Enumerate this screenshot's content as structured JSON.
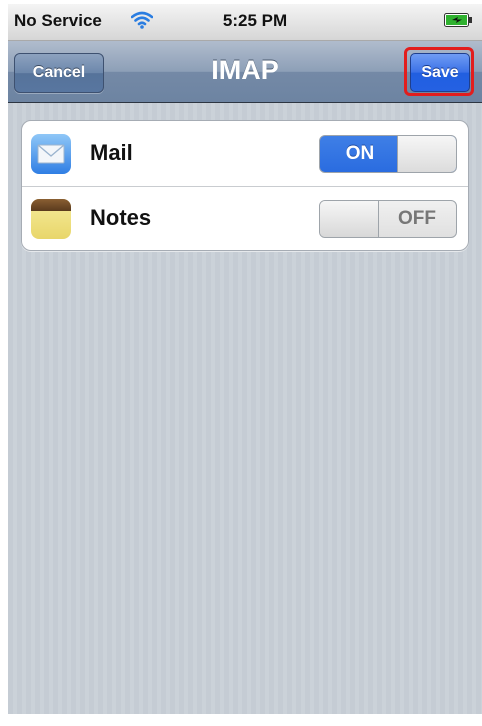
{
  "status_bar": {
    "carrier": "No Service",
    "wifi_icon": "wifi-icon",
    "time": "5:25 PM",
    "battery_icon": "battery-charging-icon"
  },
  "nav_bar": {
    "title": "IMAP",
    "cancel_label": "Cancel",
    "save_label": "Save",
    "save_highlight_color": "#e21d1d"
  },
  "settings": [
    {
      "label": "Mail",
      "icon": "mail-icon",
      "toggle": "ON",
      "enabled": true
    },
    {
      "label": "Notes",
      "icon": "notes-icon",
      "toggle": "OFF",
      "enabled": false
    }
  ],
  "colors": {
    "accent_blue": "#2a6ce0",
    "nav_bar": "#6d84a2",
    "background": "#c5ccd4"
  }
}
